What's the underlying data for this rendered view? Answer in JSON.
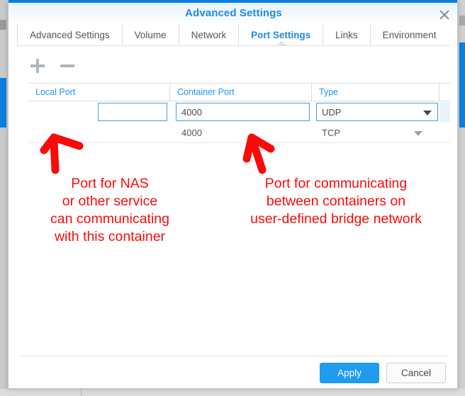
{
  "window": {
    "title": "Advanced Settings",
    "close_icon": "close-icon"
  },
  "tabs": [
    {
      "label": "Advanced Settings",
      "active": false
    },
    {
      "label": "Volume",
      "active": false
    },
    {
      "label": "Network",
      "active": false
    },
    {
      "label": "Port Settings",
      "active": true
    },
    {
      "label": "Links",
      "active": false
    },
    {
      "label": "Environment",
      "active": false
    }
  ],
  "toolbar": {
    "add_icon": "plus-icon",
    "remove_icon": "minus-icon"
  },
  "grid": {
    "columns": [
      "Local Port",
      "Container Port",
      "Type"
    ],
    "rows": [
      {
        "editing": true,
        "local_port": "",
        "local_port_placeholder": "",
        "container_port": "4000",
        "type": "UDP"
      },
      {
        "editing": false,
        "local_port": "",
        "container_port": "4000",
        "type": "TCP"
      }
    ]
  },
  "footer": {
    "apply_label": "Apply",
    "cancel_label": "Cancel"
  },
  "annotations": {
    "left_text": "Port for NAS\nor other service\ncan communicating\nwith this container",
    "right_text": "Port for communicating\nbetween containers on\nuser-defined bridge network",
    "color": "#fb0a0a",
    "left_arrow": "up-arrow-annotation",
    "right_arrow": "up-arrow-annotation"
  },
  "colors": {
    "accent": "#1f8ae5",
    "primary_button": "#1f9bef",
    "annotation_red": "#fb0a0a",
    "header_link": "#2196f3"
  }
}
